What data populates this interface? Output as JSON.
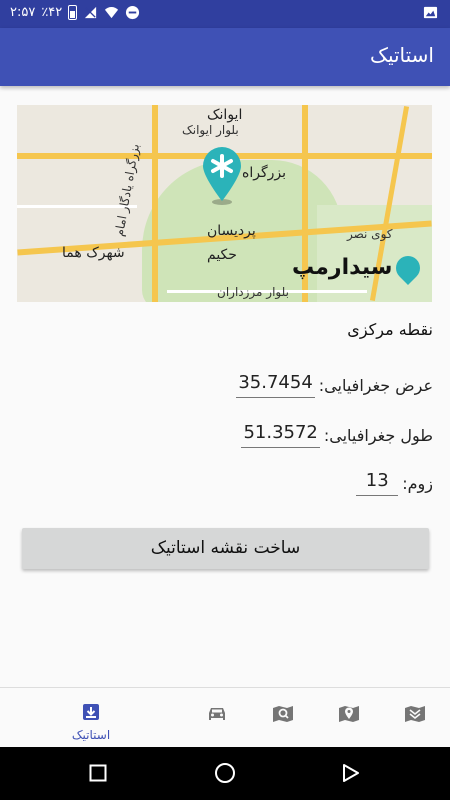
{
  "status_bar": {
    "time": "۲:۵۷",
    "battery": "٪۴۲",
    "icons": [
      "battery-icon",
      "no-sim-icon",
      "wifi-icon",
      "dnd-icon",
      "image-notification-icon"
    ]
  },
  "app_bar": {
    "title": "استاتیک"
  },
  "map": {
    "labels": {
      "ekbatan": "ایوانک",
      "ekbatan_blvd": "بلوار ایوانک",
      "bozorgrah": "بزرگراه",
      "pardisan": "پردیسان",
      "hakim": "حکیم",
      "shahrak_homa": "شهرک هما",
      "yadegar": "بزرگراه یادگار امام",
      "marzdaran": "بلوار مرزداران",
      "kooy_nasr": "کوی نصر"
    },
    "brand": "سیدارمپ",
    "pin_color": "#2bb3b9"
  },
  "form": {
    "section_title": "نقطه مرکزی",
    "latitude_label": "عرض جغرافیایی:",
    "latitude_value": "35.7454",
    "longitude_label": "طول جغرافیایی:",
    "longitude_value": "51.3572",
    "zoom_label": "زوم:",
    "zoom_value": "13"
  },
  "build_button": {
    "label": "ساخت نقشه استاتیک"
  },
  "bottom_nav": {
    "items": [
      {
        "icon": "static-map-icon",
        "label": "استاتیک",
        "active": true
      },
      {
        "icon": "car-icon",
        "label": ""
      },
      {
        "icon": "search-map-icon",
        "label": ""
      },
      {
        "icon": "map-pin-icon",
        "label": ""
      },
      {
        "icon": "map-layers-icon",
        "label": ""
      }
    ]
  },
  "colors": {
    "primary": "#3f51b5",
    "primary_dark": "#303f9f",
    "accent": "#2bb3b9"
  }
}
